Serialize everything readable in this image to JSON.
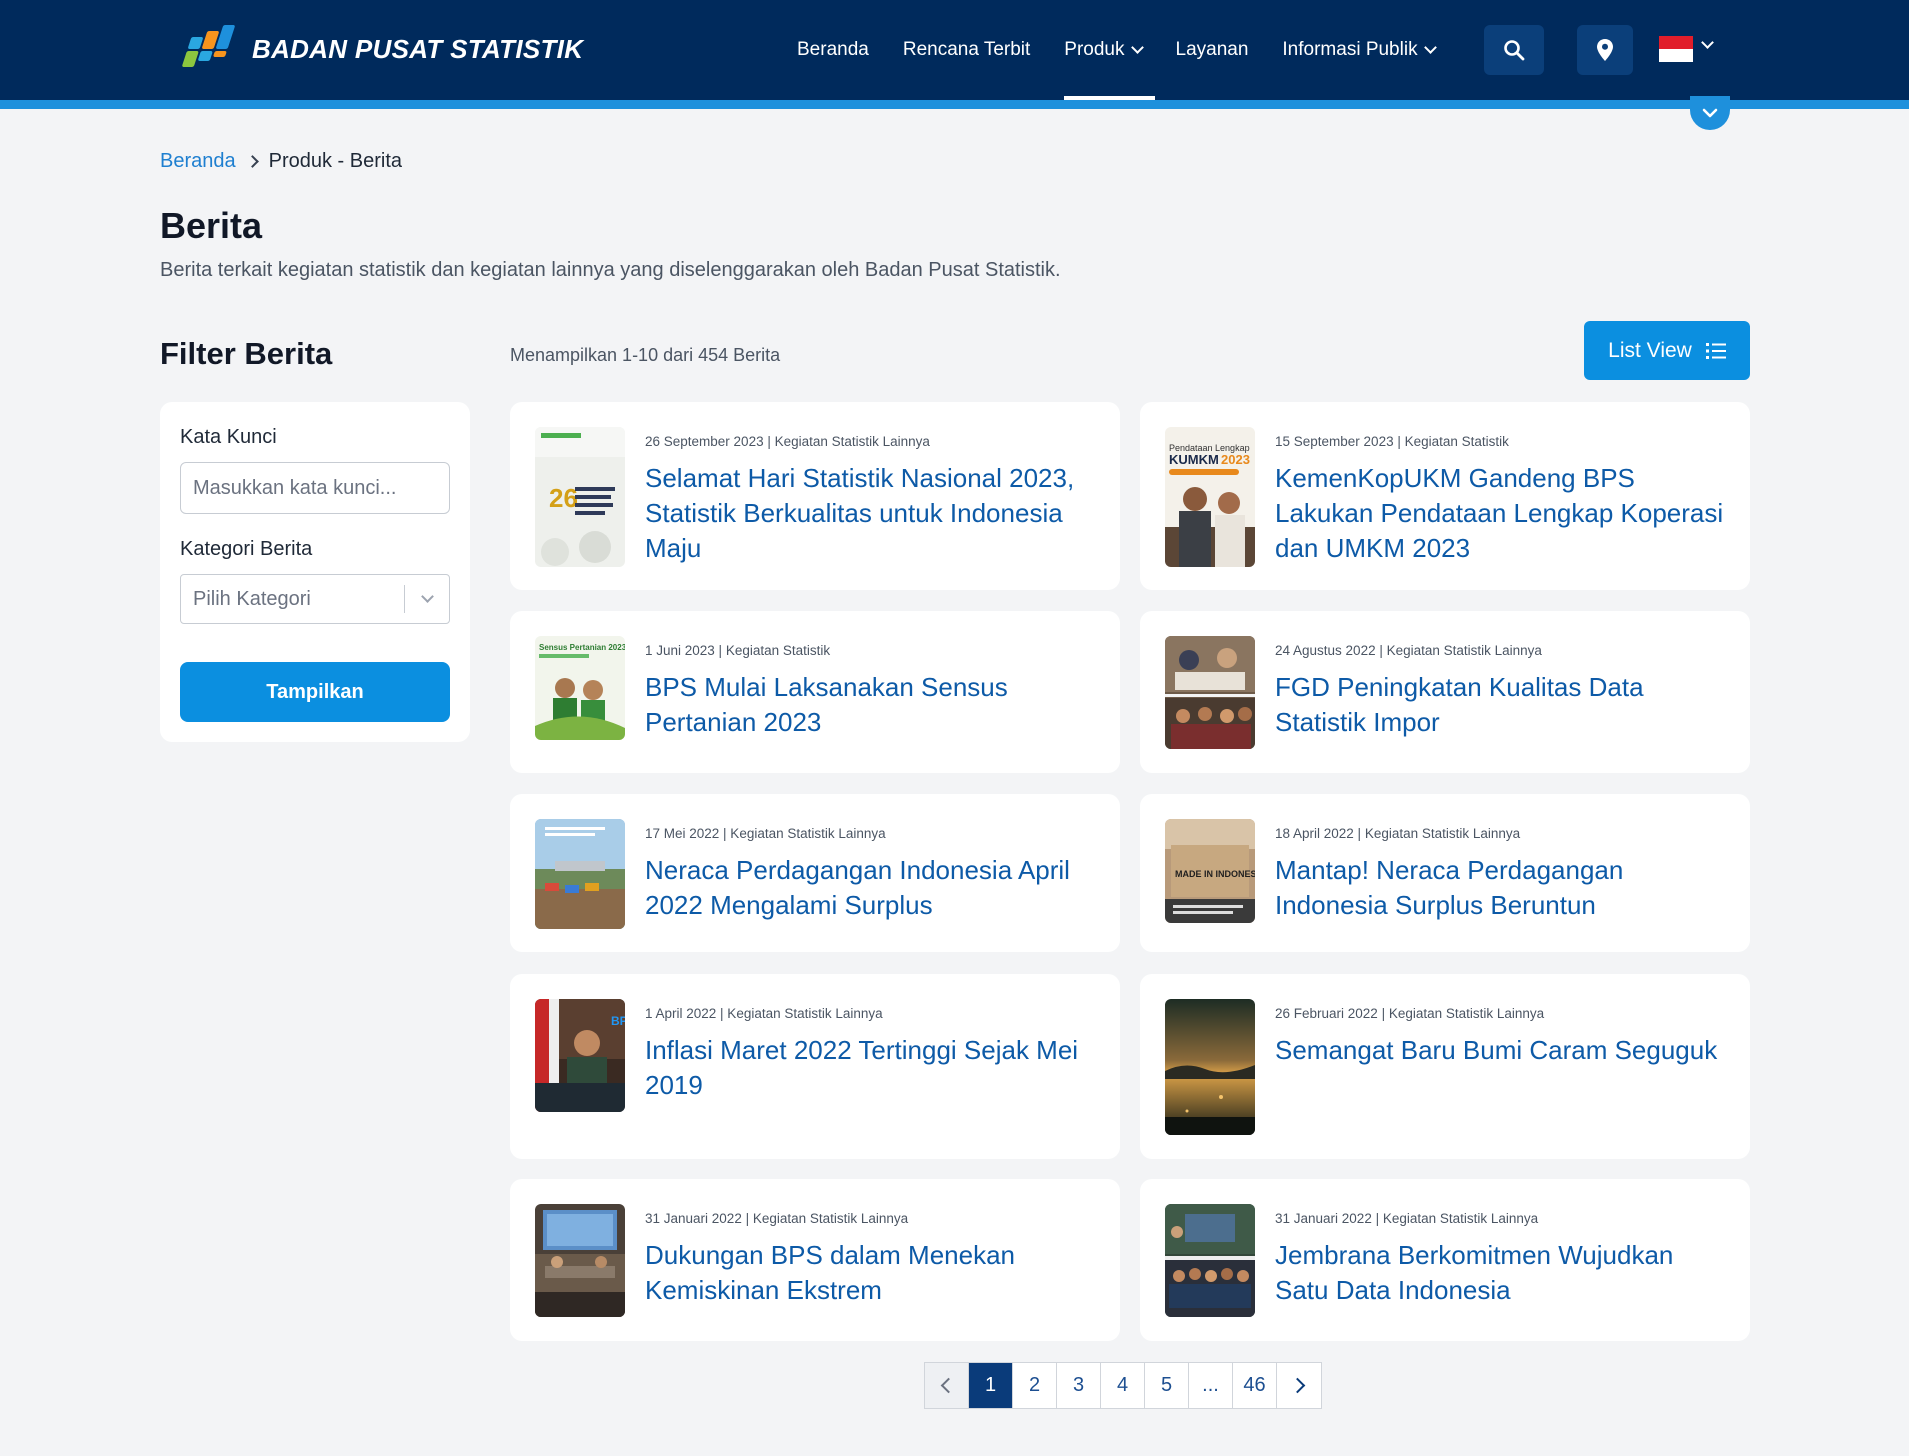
{
  "header": {
    "logo_text": "BADAN PUSAT STATISTIK",
    "nav": [
      {
        "label": "Beranda"
      },
      {
        "label": "Rencana Terbit"
      },
      {
        "label": "Produk"
      },
      {
        "label": "Layanan"
      },
      {
        "label": "Informasi Publik"
      }
    ],
    "icons": [
      "search-icon",
      "location-pin-icon",
      "indonesia-flag-icon",
      "chevron-down-icon"
    ],
    "colors": {
      "bar": "#002a5c",
      "stripe": "#1e90dc",
      "accent": "#0b8fe0"
    }
  },
  "breadcrumb": {
    "home": "Beranda",
    "current": "Produk - Berita"
  },
  "page": {
    "title": "Berita",
    "description": "Berita terkait kegiatan statistik dan kegiatan lainnya yang diselenggarakan oleh Badan Pusat Statistik."
  },
  "filter": {
    "title": "Filter Berita",
    "keyword_label": "Kata Kunci",
    "keyword_placeholder": "Masukkan kata kunci...",
    "category_label": "Kategori Berita",
    "category_placeholder": "Pilih Kategori",
    "submit_label": "Tampilkan"
  },
  "results": {
    "count_text": "Menampilkan 1-10 dari 454 Berita",
    "view_toggle_label": "List View",
    "items": [
      {
        "meta": "26 September 2023 | Kegiatan Statistik Lainnya",
        "title": "Selamat Hari Statistik Nasional 2023, Statistik Berkualitas untuk Indonesia Maju",
        "thumb": "hari-statistik-poster"
      },
      {
        "meta": "15 September 2023 | Kegiatan Statistik",
        "title": "KemenKopUKM Gandeng BPS Lakukan Pendataan Lengkap Koperasi dan UMKM 2023",
        "thumb": "kumkm-2023-poster"
      },
      {
        "meta": "1 Juni 2023 | Kegiatan Statistik",
        "title": "BPS Mulai Laksanakan Sensus Pertanian 2023",
        "thumb": "sensus-pertanian-poster"
      },
      {
        "meta": "24 Agustus 2022 | Kegiatan Statistik Lainnya",
        "title": "FGD Peningkatan Kualitas Data Statistik Impor",
        "thumb": "fgd-photo"
      },
      {
        "meta": "17 Mei 2022 | Kegiatan Statistik Lainnya",
        "title": "Neraca Perdagangan Indonesia April 2022 Mengalami Surplus",
        "thumb": "port-photo"
      },
      {
        "meta": "18 April 2022 | Kegiatan Statistik Lainnya",
        "title": "Mantap! Neraca Perdagangan Indonesia Surplus Beruntun",
        "thumb": "made-in-indonesia-photo"
      },
      {
        "meta": "1 April 2022 | Kegiatan Statistik Lainnya",
        "title": "Inflasi Maret 2022 Tertinggi Sejak Mei 2019",
        "thumb": "press-conference-photo"
      },
      {
        "meta": "26 Februari 2022 | Kegiatan Statistik Lainnya",
        "title": "Semangat Baru Bumi Caram Seguguk",
        "thumb": "sunset-photo"
      },
      {
        "meta": "31 Januari 2022 | Kegiatan Statistik Lainnya",
        "title": "Dukungan BPS dalam Menekan Kemiskinan Ekstrem",
        "thumb": "meeting-room-photo"
      },
      {
        "meta": "31 Januari 2022 | Kegiatan Statistik Lainnya",
        "title": "Jembrana Berkomitmen Wujudkan Satu Data Indonesia",
        "thumb": "group-photo"
      }
    ]
  },
  "pagination": {
    "pages": [
      "1",
      "2",
      "3",
      "4",
      "5",
      "...",
      "46"
    ],
    "current": "1"
  }
}
